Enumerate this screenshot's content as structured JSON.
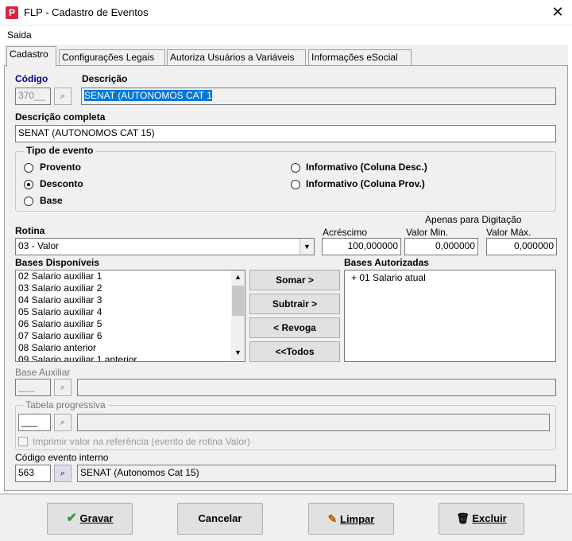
{
  "window": {
    "title": "FLP - Cadastro de Eventos",
    "close": "✕",
    "icon": "P"
  },
  "menu": {
    "saida": "Saida"
  },
  "tabs": [
    "Cadastro",
    "Configurações Legais",
    "Autoriza Usuários a Variáveis",
    "Informações eSocial"
  ],
  "codigo": {
    "label": "Código",
    "value": "370__"
  },
  "descricao": {
    "label": "Descrição",
    "value": "SENAT (AUTONOMOS CAT 1"
  },
  "descricao_completa": {
    "label": "Descrição completa",
    "value": "SENAT (AUTONOMOS CAT 15)"
  },
  "tipo_evento": {
    "label": "Tipo de evento",
    "options": [
      "Provento",
      "Desconto",
      "Base",
      "Informativo (Coluna Desc.)",
      "Informativo (Coluna Prov.)"
    ],
    "selected": "Desconto"
  },
  "rotina": {
    "label": "Rotina",
    "value": "03 - Valor"
  },
  "apenas_digitacao": "Apenas para Digitação",
  "acrescimo": {
    "label": "Acréscimo",
    "value": "100,000000"
  },
  "valor_min": {
    "label": "Valor Min.",
    "value": "0,000000"
  },
  "valor_max": {
    "label": "Valor Máx.",
    "value": "0,000000"
  },
  "bases_disponiveis": {
    "label": "Bases Disponíveis",
    "items": [
      "02 Salario auxiliar 1",
      "03 Salario auxiliar 2",
      "04 Salario auxiliar 3",
      "05 Salario auxiliar 4",
      "06 Salario auxiliar 5",
      "07 Salario auxiliar 6",
      "08 Salario anterior",
      "09 Salario auxiliar 1 anterior"
    ]
  },
  "bases_autorizadas": {
    "label": "Bases Autorizadas",
    "items": [
      "+ 01 Salario atual"
    ]
  },
  "transfer": {
    "somar": "Somar >",
    "subtrair": "Subtrair >",
    "revoga": "< Revoga",
    "todos": "<<Todos"
  },
  "base_auxiliar": {
    "label": "Base Auxiliar",
    "value": "___"
  },
  "tabela_progressiva": {
    "label": "Tabela progressiva",
    "value": "___"
  },
  "imprimir": {
    "label": "Imprimir valor na referência (evento de rotina Valor)"
  },
  "codigo_interno": {
    "label": "Código evento interno",
    "value": "563",
    "desc": "SENAT (Autonomos Cat 15)"
  },
  "buttons": {
    "gravar": "Gravar",
    "cancelar": "Cancelar",
    "limpar": "Limpar",
    "excluir": "Excluir"
  },
  "colors": {
    "accent": "#00008b",
    "selection": "#0078d7",
    "app_icon": "#d7263d"
  }
}
